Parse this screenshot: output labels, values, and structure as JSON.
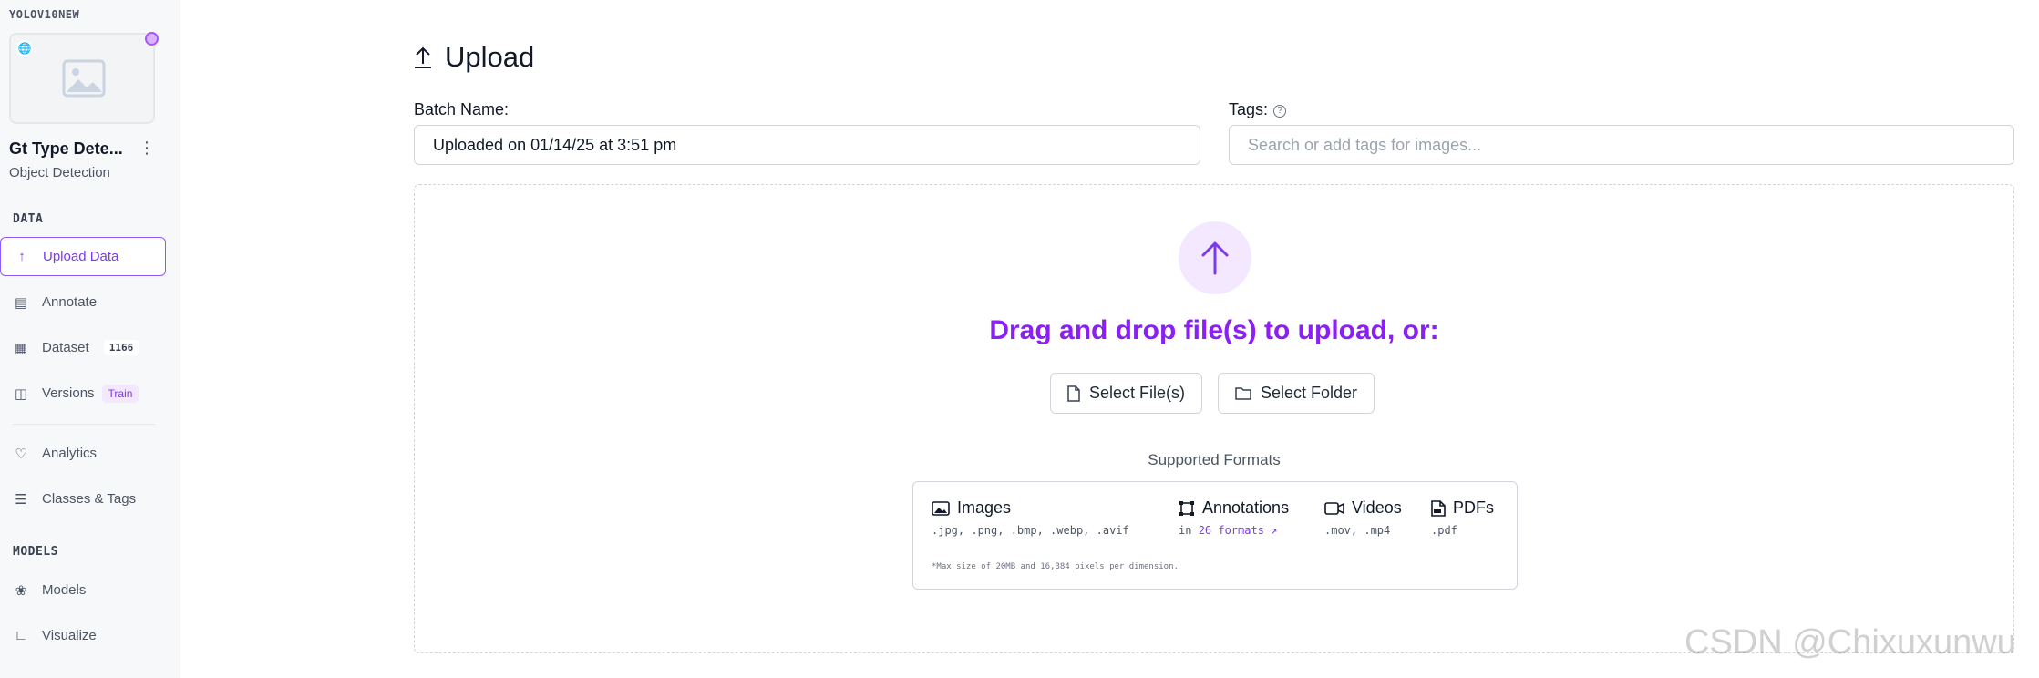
{
  "sidebar": {
    "workspace_name": "YOLOV10NEW",
    "project_title": "Gt Type Dete...",
    "project_type": "Object Detection",
    "data_section": "DATA",
    "models_section": "MODELS",
    "items": [
      {
        "label": "Upload Data",
        "icon": "upload-icon"
      },
      {
        "label": "Annotate",
        "icon": "annotate-icon"
      },
      {
        "label": "Dataset",
        "icon": "images-icon",
        "badge": "1166"
      },
      {
        "label": "Versions",
        "icon": "versions-icon",
        "pill": "Train"
      },
      {
        "label": "Analytics",
        "icon": "heartbeat-icon"
      },
      {
        "label": "Classes & Tags",
        "icon": "list-icon"
      },
      {
        "label": "Models",
        "icon": "models-icon"
      },
      {
        "label": "Visualize",
        "icon": "chart-icon"
      }
    ]
  },
  "main": {
    "title": "Upload",
    "batch_label": "Batch Name:",
    "batch_value": "Uploaded on 01/14/25 at 3:51 pm",
    "tags_label": "Tags:",
    "tags_placeholder": "Search or add tags for images...",
    "drop_text": "Drag and drop file(s) to upload, or:",
    "select_files": "Select File(s)",
    "select_folder": "Select Folder",
    "supported_title": "Supported Formats",
    "formats": {
      "images_title": "Images",
      "images_ext": ".jpg, .png, .bmp, .webp, .avif",
      "annotations_title": "Annotations",
      "annotations_prefix": "in",
      "annotations_link": "26 formats",
      "videos_title": "Videos",
      "videos_ext": ".mov, .mp4",
      "pdfs_title": "PDFs",
      "pdfs_ext": ".pdf",
      "note": "*Max size of 20MB and 16,384 pixels per dimension."
    }
  },
  "watermark": "CSDN @Chixuxunwu",
  "colors": {
    "accent": "#8b1ff5",
    "accent_light": "#f3e8ff"
  }
}
